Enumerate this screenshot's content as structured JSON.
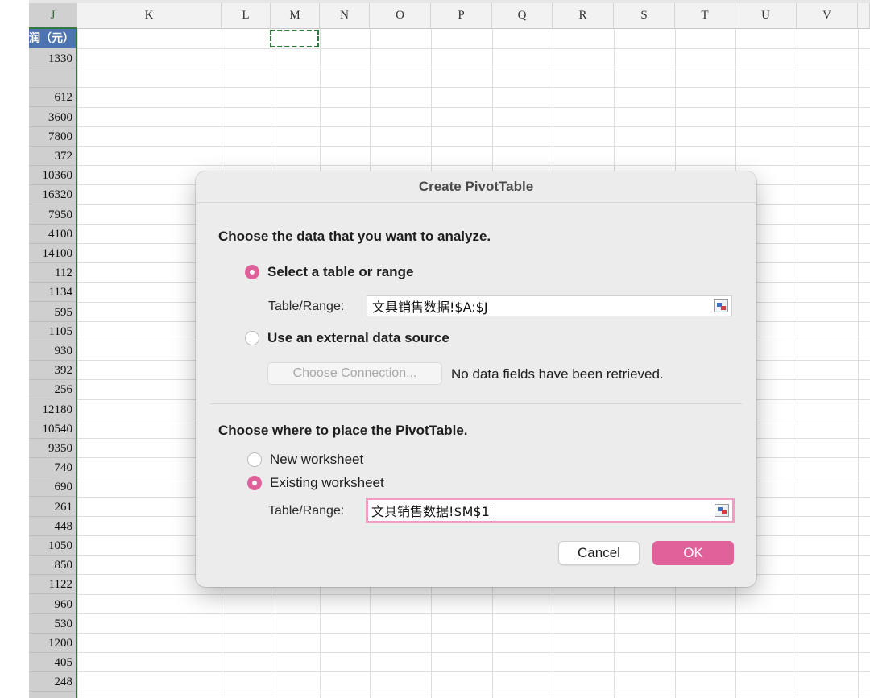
{
  "spreadsheet": {
    "columns": [
      "J",
      "K",
      "L",
      "M",
      "N",
      "O",
      "P",
      "Q",
      "R",
      "S",
      "T",
      "U",
      "V"
    ],
    "selected_column": "J",
    "j_header_text": "润（元）",
    "j_values": [
      "1330",
      "",
      "612",
      "3600",
      "7800",
      "372",
      "10360",
      "16320",
      "7950",
      "4100",
      "14100",
      "112",
      "1134",
      "595",
      "1105",
      "930",
      "392",
      "256",
      "12180",
      "10540",
      "9350",
      "740",
      "690",
      "261",
      "448",
      "1050",
      "850",
      "1122",
      "960",
      "530",
      "1200",
      "405",
      "248"
    ]
  },
  "dialog": {
    "title": "Create PivotTable",
    "section1_label": "Choose the data that you want to analyze.",
    "option_table_range": "Select a table or range",
    "table_range_label": "Table/Range:",
    "table_range_value": "文具销售数据!$A:$J",
    "option_external": "Use an external data source",
    "choose_connection_label": "Choose Connection...",
    "no_data_text": "No data fields have been retrieved.",
    "section2_label": "Choose where to place the PivotTable.",
    "option_new_worksheet": "New worksheet",
    "option_existing_worksheet": "Existing worksheet",
    "dest_range_label": "Table/Range:",
    "dest_range_value": "文具销售数据!$M$1",
    "cancel_label": "Cancel",
    "ok_label": "OK",
    "accent_color": "#e0619a"
  }
}
